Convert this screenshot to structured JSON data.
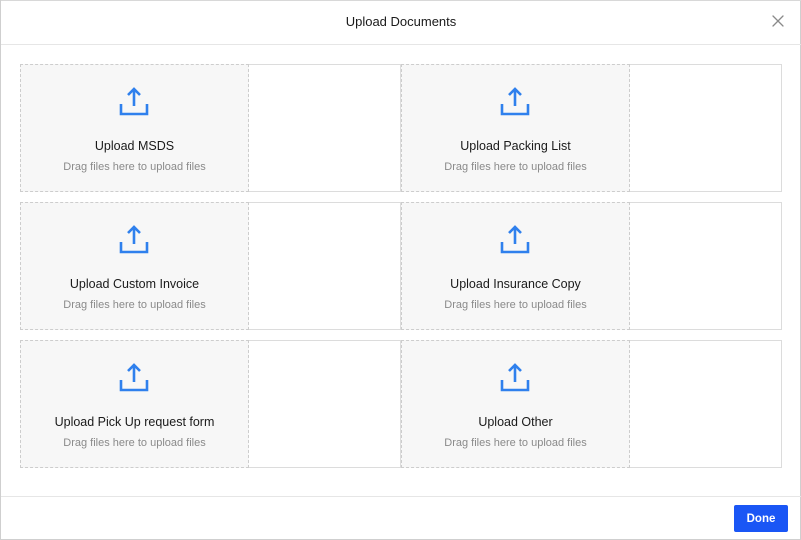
{
  "dialog": {
    "title": "Upload Documents",
    "close_icon": "close-icon"
  },
  "uploads": [
    {
      "label": "Upload MSDS",
      "hint": "Drag files here to upload files",
      "icon": "upload-icon"
    },
    {
      "label": "Upload Packing List",
      "hint": "Drag files here to upload files",
      "icon": "upload-icon"
    },
    {
      "label": "Upload Custom Invoice",
      "hint": "Drag files here to upload files",
      "icon": "upload-icon"
    },
    {
      "label": "Upload Insurance Copy",
      "hint": "Drag files here to upload files",
      "icon": "upload-icon"
    },
    {
      "label": "Upload Pick Up request form",
      "hint": "Drag files here to upload files",
      "icon": "upload-icon"
    },
    {
      "label": "Upload Other",
      "hint": "Drag files here to upload files",
      "icon": "upload-icon"
    }
  ],
  "footer": {
    "done_label": "Done"
  },
  "colors": {
    "accent": "#1a56f5",
    "icon": "#2f80ed",
    "dropzone_bg": "#f7f7f7"
  }
}
